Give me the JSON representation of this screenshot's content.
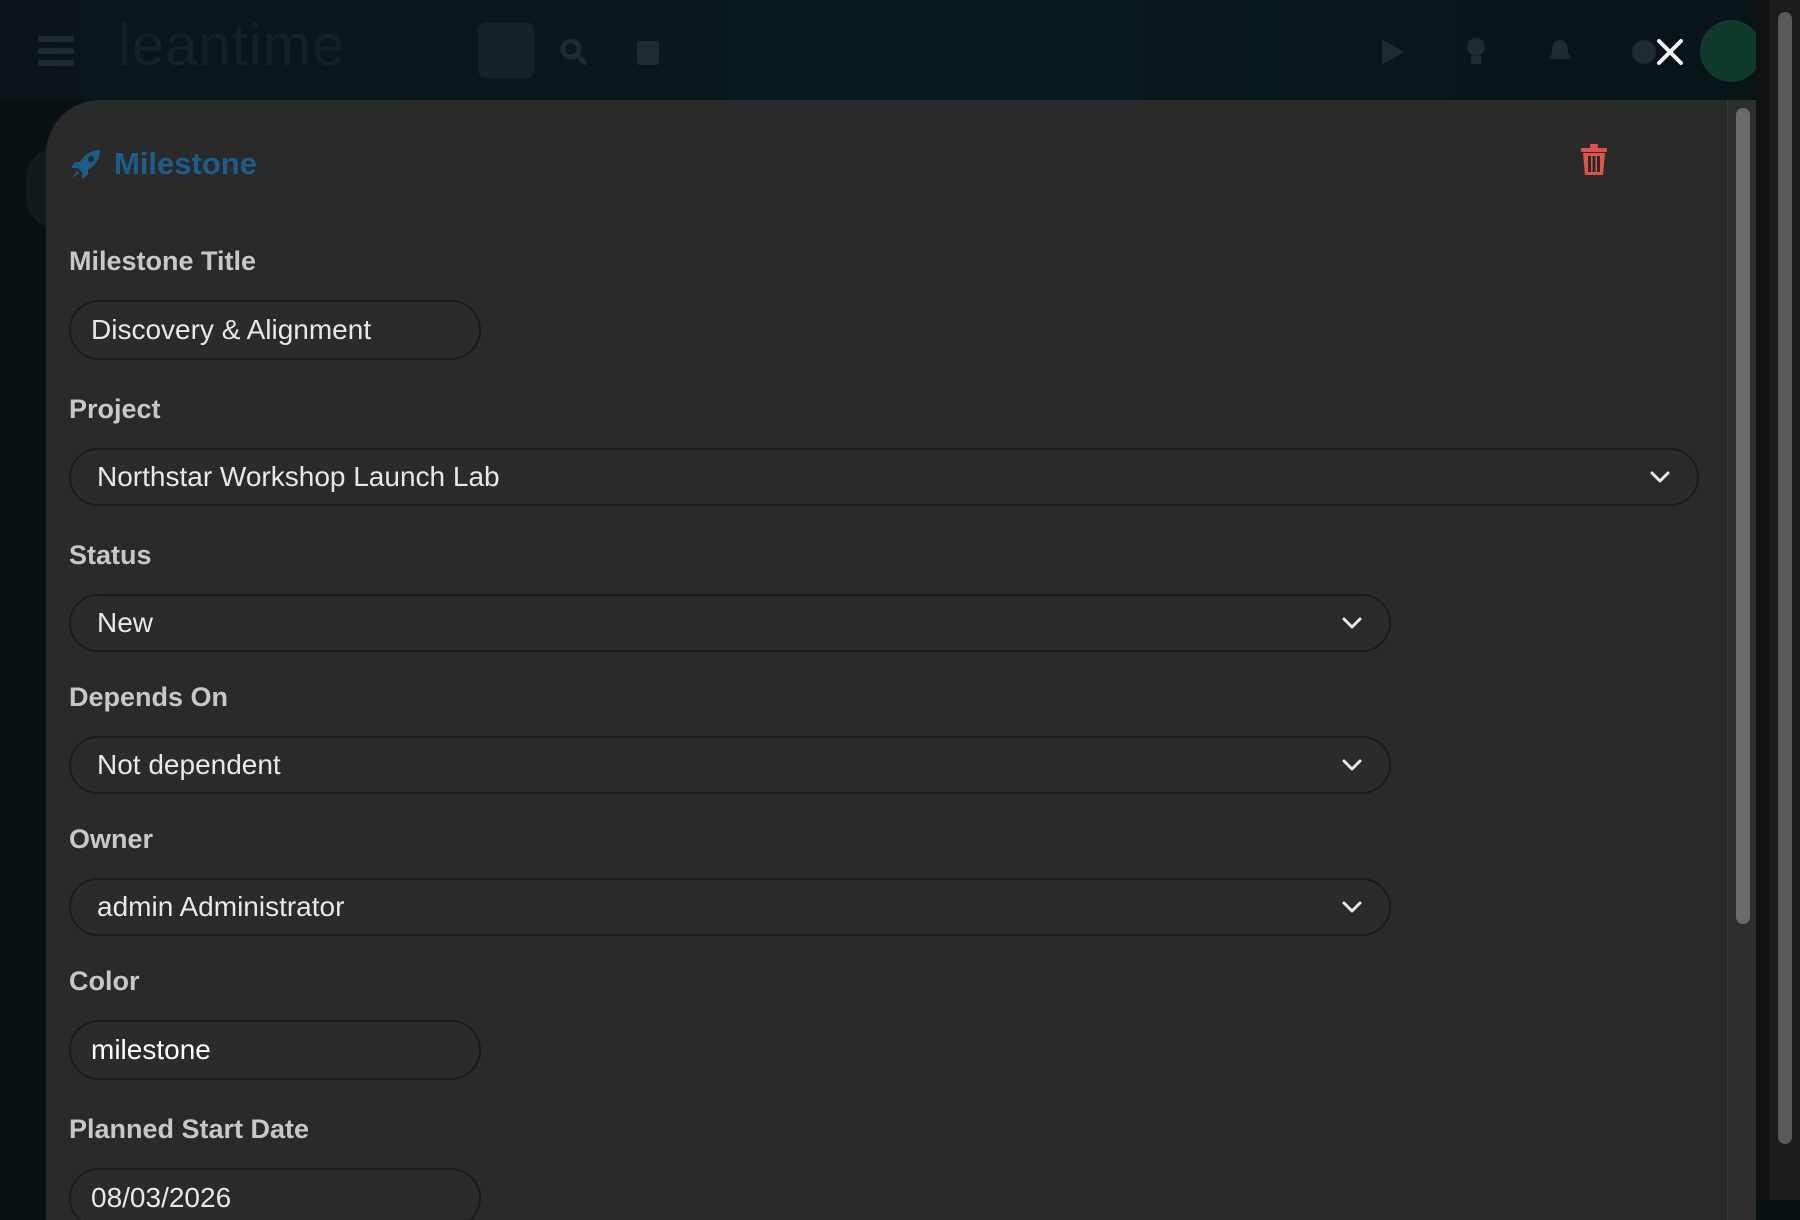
{
  "header": {
    "logo_text": "leantime",
    "accent_color": "#1c5d8a",
    "danger_color": "#e0554b"
  },
  "modal": {
    "title": "Milestone",
    "title_icon": "rocket-icon",
    "delete_icon": "trash-icon",
    "close_icon": "close-icon"
  },
  "form": {
    "title_label": "Milestone Title",
    "title_value": "Discovery & Alignment",
    "project_label": "Project",
    "project_value": "Northstar Workshop Launch Lab",
    "status_label": "Status",
    "status_value": "New",
    "depends_label": "Depends On",
    "depends_value": "Not dependent",
    "owner_label": "Owner",
    "owner_value": "admin Administrator",
    "color_label": "Color",
    "color_value": "milestone",
    "start_label": "Planned Start Date",
    "start_value": "08/03/2026"
  }
}
